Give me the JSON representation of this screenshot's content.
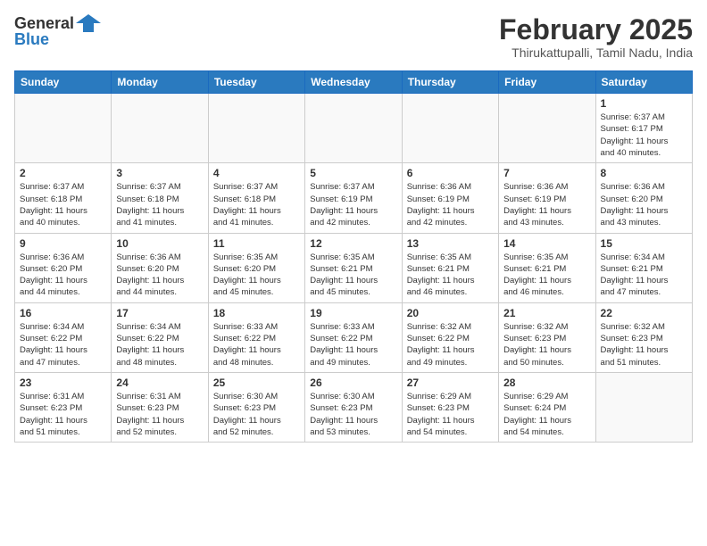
{
  "header": {
    "logo_line1": "General",
    "logo_line2": "Blue",
    "month": "February 2025",
    "location": "Thirukattupalli, Tamil Nadu, India"
  },
  "days_of_week": [
    "Sunday",
    "Monday",
    "Tuesday",
    "Wednesday",
    "Thursday",
    "Friday",
    "Saturday"
  ],
  "weeks": [
    [
      {
        "day": "",
        "info": ""
      },
      {
        "day": "",
        "info": ""
      },
      {
        "day": "",
        "info": ""
      },
      {
        "day": "",
        "info": ""
      },
      {
        "day": "",
        "info": ""
      },
      {
        "day": "",
        "info": ""
      },
      {
        "day": "1",
        "info": "Sunrise: 6:37 AM\nSunset: 6:17 PM\nDaylight: 11 hours\nand 40 minutes."
      }
    ],
    [
      {
        "day": "2",
        "info": "Sunrise: 6:37 AM\nSunset: 6:18 PM\nDaylight: 11 hours\nand 40 minutes."
      },
      {
        "day": "3",
        "info": "Sunrise: 6:37 AM\nSunset: 6:18 PM\nDaylight: 11 hours\nand 41 minutes."
      },
      {
        "day": "4",
        "info": "Sunrise: 6:37 AM\nSunset: 6:18 PM\nDaylight: 11 hours\nand 41 minutes."
      },
      {
        "day": "5",
        "info": "Sunrise: 6:37 AM\nSunset: 6:19 PM\nDaylight: 11 hours\nand 42 minutes."
      },
      {
        "day": "6",
        "info": "Sunrise: 6:36 AM\nSunset: 6:19 PM\nDaylight: 11 hours\nand 42 minutes."
      },
      {
        "day": "7",
        "info": "Sunrise: 6:36 AM\nSunset: 6:19 PM\nDaylight: 11 hours\nand 43 minutes."
      },
      {
        "day": "8",
        "info": "Sunrise: 6:36 AM\nSunset: 6:20 PM\nDaylight: 11 hours\nand 43 minutes."
      }
    ],
    [
      {
        "day": "9",
        "info": "Sunrise: 6:36 AM\nSunset: 6:20 PM\nDaylight: 11 hours\nand 44 minutes."
      },
      {
        "day": "10",
        "info": "Sunrise: 6:36 AM\nSunset: 6:20 PM\nDaylight: 11 hours\nand 44 minutes."
      },
      {
        "day": "11",
        "info": "Sunrise: 6:35 AM\nSunset: 6:20 PM\nDaylight: 11 hours\nand 45 minutes."
      },
      {
        "day": "12",
        "info": "Sunrise: 6:35 AM\nSunset: 6:21 PM\nDaylight: 11 hours\nand 45 minutes."
      },
      {
        "day": "13",
        "info": "Sunrise: 6:35 AM\nSunset: 6:21 PM\nDaylight: 11 hours\nand 46 minutes."
      },
      {
        "day": "14",
        "info": "Sunrise: 6:35 AM\nSunset: 6:21 PM\nDaylight: 11 hours\nand 46 minutes."
      },
      {
        "day": "15",
        "info": "Sunrise: 6:34 AM\nSunset: 6:21 PM\nDaylight: 11 hours\nand 47 minutes."
      }
    ],
    [
      {
        "day": "16",
        "info": "Sunrise: 6:34 AM\nSunset: 6:22 PM\nDaylight: 11 hours\nand 47 minutes."
      },
      {
        "day": "17",
        "info": "Sunrise: 6:34 AM\nSunset: 6:22 PM\nDaylight: 11 hours\nand 48 minutes."
      },
      {
        "day": "18",
        "info": "Sunrise: 6:33 AM\nSunset: 6:22 PM\nDaylight: 11 hours\nand 48 minutes."
      },
      {
        "day": "19",
        "info": "Sunrise: 6:33 AM\nSunset: 6:22 PM\nDaylight: 11 hours\nand 49 minutes."
      },
      {
        "day": "20",
        "info": "Sunrise: 6:32 AM\nSunset: 6:22 PM\nDaylight: 11 hours\nand 49 minutes."
      },
      {
        "day": "21",
        "info": "Sunrise: 6:32 AM\nSunset: 6:23 PM\nDaylight: 11 hours\nand 50 minutes."
      },
      {
        "day": "22",
        "info": "Sunrise: 6:32 AM\nSunset: 6:23 PM\nDaylight: 11 hours\nand 51 minutes."
      }
    ],
    [
      {
        "day": "23",
        "info": "Sunrise: 6:31 AM\nSunset: 6:23 PM\nDaylight: 11 hours\nand 51 minutes."
      },
      {
        "day": "24",
        "info": "Sunrise: 6:31 AM\nSunset: 6:23 PM\nDaylight: 11 hours\nand 52 minutes."
      },
      {
        "day": "25",
        "info": "Sunrise: 6:30 AM\nSunset: 6:23 PM\nDaylight: 11 hours\nand 52 minutes."
      },
      {
        "day": "26",
        "info": "Sunrise: 6:30 AM\nSunset: 6:23 PM\nDaylight: 11 hours\nand 53 minutes."
      },
      {
        "day": "27",
        "info": "Sunrise: 6:29 AM\nSunset: 6:23 PM\nDaylight: 11 hours\nand 54 minutes."
      },
      {
        "day": "28",
        "info": "Sunrise: 6:29 AM\nSunset: 6:24 PM\nDaylight: 11 hours\nand 54 minutes."
      },
      {
        "day": "",
        "info": ""
      }
    ]
  ]
}
